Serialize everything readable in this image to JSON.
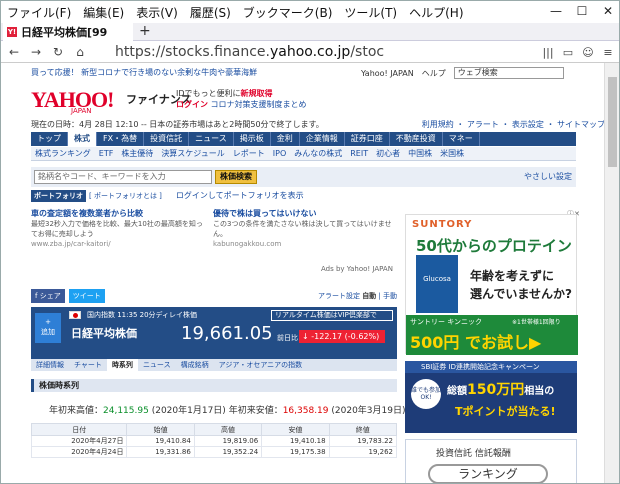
{
  "browser": {
    "menu": [
      "ファイル(F)",
      "編集(E)",
      "表示(V)",
      "履歴(S)",
      "ブックマーク(B)",
      "ツール(T)",
      "ヘルプ(H)"
    ],
    "window_buttons": [
      "—",
      "☐",
      "✕"
    ],
    "tab_title": "日経平均株価[99",
    "tab_favicon": "Y!",
    "new_tab": "+",
    "url_prefix": "https://stocks.finance.",
    "url_domain": "yahoo.co.jp",
    "url_suffix": "/stoc",
    "nav_icons": [
      "←",
      "→",
      "↻",
      "⌂"
    ],
    "right_icons": [
      "|||",
      "▭",
      "☺",
      "≡"
    ]
  },
  "page": {
    "top_notice": "買って応援！ 新型コロナで行き場のない余剰な牛肉や豪華海鮮",
    "top_links": [
      "Yahoo! JAPAN",
      "ヘルプ"
    ],
    "web_search_placeholder": "ウェブ検索",
    "logo": "YAHOO!",
    "logo_sub": "JAPAN",
    "finance": "ファイナンス",
    "id_line1": "IDでもっと便利に",
    "id_line1_link": "新規取得",
    "login": "ログイン",
    "covid_link": "コロナ対策支援制度まとめ",
    "date_line": "現在の日時：4月 28日 12:10 -- 日本の証券市場はあと2時間50分で終了します。",
    "right_links": "利用規約 ・ アラート ・ 表示設定 ・ サイトマップ",
    "global_nav": [
      "トップ",
      "株式",
      "FX・為替",
      "投資信託",
      "ニュース",
      "掲示板",
      "金利",
      "企業情報",
      "証券口座",
      "不動産投資",
      "マネー"
    ],
    "sub_nav": [
      "株式ランキング",
      "ETF",
      "株主優待",
      "決算スケジュール",
      "レポート",
      "IPO",
      "みんなの株式",
      "REIT",
      "初心者",
      "中国株",
      "米国株"
    ],
    "search_placeholder": "銘柄名やコード、キーワードを入力",
    "search_button": "株価検索",
    "easy_setting": "やさしい設定",
    "portfolio_label": "ポートフォリオ",
    "portfolio_add": "[ ポートフォリオとは ]",
    "portfolio_login": "ログインしてポートフォリオを表示",
    "ad1_title": "車の査定額を複数業者から比較",
    "ad1_body": "最短32秒入力で価格を比較、最大10社の最高額を知ってお得に売却しよう",
    "ad1_url": "www.zba.jp/car-kaitori/",
    "ad2_title": "優待で株は買ってはいけない",
    "ad2_body": "この3つの条件を満たさない株は決して買ってはいけません。",
    "ad2_url": "kabunogakkou.com",
    "ads_by": "Ads by Yahoo! JAPAN",
    "share_fb": "f シェア",
    "share_tw": "ツイート",
    "alerts": "アラート設定",
    "auto_label": "自動",
    "manual_label": "手動",
    "quote_add": "追加",
    "quote_sub": "国内指数 11:35 20分ディレイ株価",
    "quote_name": "日経平均株価",
    "vip_link": "リアルタイム株価はVIP倶楽部で",
    "quote_price": "19,661.05",
    "prev_label": "前日比",
    "quote_change": "-122.17 (-0.62%)",
    "quote_tabs": [
      "詳細情報",
      "チャート",
      "時系列",
      "ニュース",
      "構成銘柄",
      "アジア・オセアニアの指数"
    ],
    "section_title": "株価時系列",
    "hi_label": "年初来高値：",
    "hi_val": "24,115.95",
    "hi_date": "(2020年1月17日)",
    "lo_label": "年初来安値：",
    "lo_val": "16,358.19",
    "lo_date": "(2020年3月19日)",
    "table_headers": [
      "日付",
      "始値",
      "高値",
      "安値",
      "終値"
    ],
    "rows": [
      [
        "2020年4月27日",
        "19,410.84",
        "19,819.06",
        "19,410.18",
        "19,783.22"
      ],
      [
        "2020年4月24日",
        "19,331.86",
        "19,352.24",
        "19,175.38",
        "19,262"
      ]
    ],
    "ad_mark": "ⓘ✕",
    "rad1_brand": "SUNTORY",
    "rad1_headline": "50代からのプロテイン",
    "rad1_product": "Glucosa",
    "rad1_text1": "年齢を考えずに",
    "rad1_text2": "選んでいませんか?",
    "rad1_company": "サントリー キンニック",
    "rad1_note": "※1世帯様1回限り",
    "rad1_price": "500円 でお試し▶",
    "rad2_top": "SBI証券 ID連携開始記念キャンペーン",
    "rad2_circle": "誰でも参加OK!",
    "rad2_line1a": "総額",
    "rad2_line1b": "150万円",
    "rad2_line1c": "相当の",
    "rad2_line2": "Tポイントが当たる!",
    "rad3_title": "投資信託 信託報酬",
    "rad3_rank": "ランキング"
  }
}
